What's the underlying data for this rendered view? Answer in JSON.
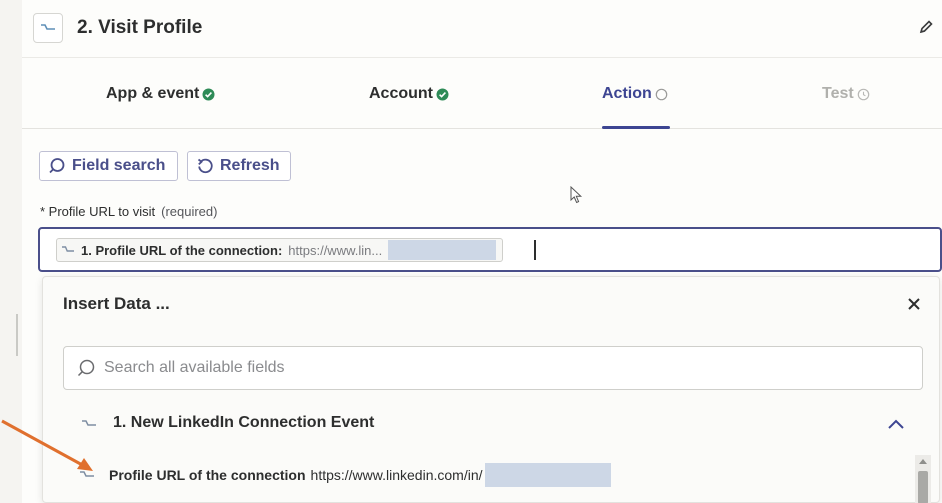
{
  "header": {
    "step_title": "2. Visit Profile"
  },
  "tabs": [
    {
      "label": "App & event",
      "state": "done"
    },
    {
      "label": "Account",
      "state": "done"
    },
    {
      "label": "Action",
      "state": "active"
    },
    {
      "label": "Test",
      "state": "disabled"
    }
  ],
  "toolbar": {
    "field_search_label": "Field search",
    "refresh_label": "Refresh"
  },
  "field": {
    "label": "* Profile URL to visit",
    "required_text": "(required)",
    "mapped_label": "1. Profile URL of the connection:",
    "mapped_value": "https://www.lin..."
  },
  "insert_panel": {
    "title": "Insert Data ...",
    "search_placeholder": "Search all available fields",
    "group_title": "1. New LinkedIn Connection Event",
    "rows": [
      {
        "label": "Profile URL of the connection",
        "value": "https://www.linkedin.com/in/"
      }
    ]
  },
  "colors": {
    "accent": "#3d4592",
    "success": "#2e8b57",
    "annotation_arrow": "#e0702e"
  },
  "icons": {
    "app": "linkedin-helper-icon",
    "edit": "pencil-icon",
    "check": "check-circle-icon",
    "pending": "empty-circle-icon",
    "search": "search-icon",
    "refresh": "refresh-icon",
    "close": "close-icon",
    "collapse": "chevron-up-icon"
  }
}
